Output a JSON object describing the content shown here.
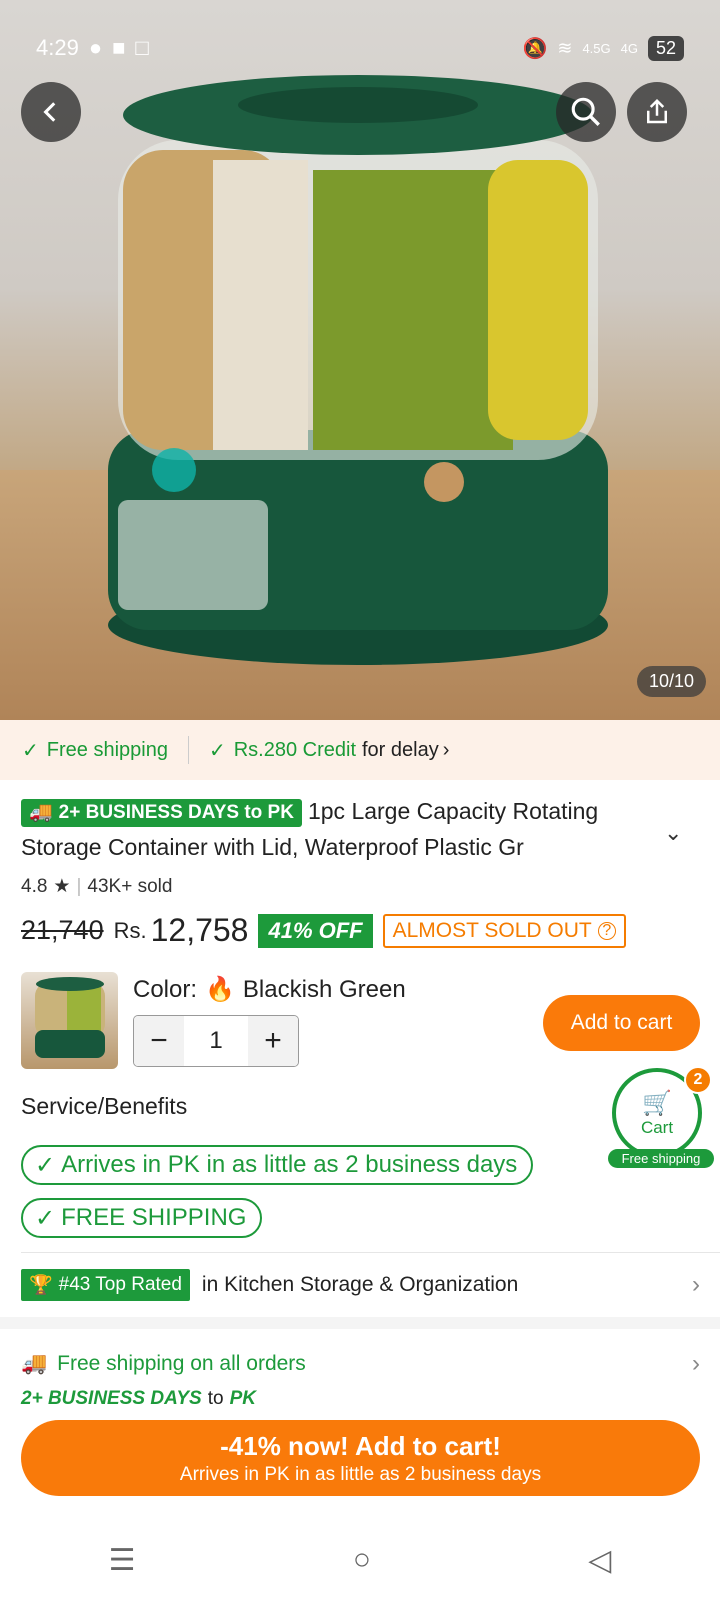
{
  "status_bar": {
    "time": "4:29",
    "network_1": "4.5G",
    "network_2": "4G",
    "battery": "52"
  },
  "gallery": {
    "counter": "10/10"
  },
  "shipping_bar": {
    "free_shipping": "Free shipping",
    "credit": "Rs.280 Credit",
    "credit_suffix": "for delay"
  },
  "product": {
    "delivery_badge": "2+ BUSINESS DAYS to PK",
    "title": "1pc Large Capacity Rotating Storage Container with Lid, Waterproof Plastic Gr",
    "rating": "4.8",
    "sold": "43K+ sold",
    "old_price": "21,740",
    "currency": "Rs.",
    "price": "12,758",
    "discount": "41% OFF",
    "stock_status": "ALMOST SOLD OUT",
    "color_label": "Color:",
    "color_value": "Blackish Green",
    "quantity": "1",
    "add_to_cart": "Add to cart"
  },
  "cart": {
    "label": "Cart",
    "count": "2",
    "free_shipping": "Free shipping"
  },
  "services": {
    "title": "Service/Benefits",
    "items": [
      "Arrives in PK in as little as 2 business days",
      "FREE SHIPPING"
    ]
  },
  "ranking": {
    "badge": "#43 Top Rated",
    "text": "in Kitchen Storage & Organization"
  },
  "shipping_info": {
    "title": "Free shipping on all orders",
    "days": "2+ BUSINESS DAYS",
    "to": "to",
    "dest": "PK"
  },
  "cta": {
    "main": "-41% now! Add to cart!",
    "sub": "Arrives in PK in as little as 2 business days"
  },
  "colors": {
    "accent_green": "#1d9a3b",
    "accent_orange": "#fa7a0a"
  }
}
